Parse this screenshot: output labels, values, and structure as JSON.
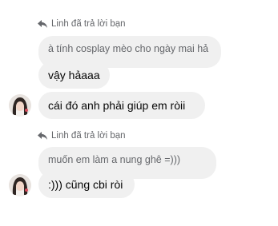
{
  "thread": {
    "blocks": [
      {
        "reply_label": "Linh đã trả lời bạn",
        "quoted_text": "à tính cosplay mèo cho ngày mai hả",
        "reply_text": "vậy hảaaa"
      },
      {
        "message_text": "cái đó anh phải giúp em ròii"
      },
      {
        "reply_label": "Linh đã trả lời bạn",
        "quoted_text": "muốn em làm a nung ghê =)))",
        "reply_text": ":))) cũng cbi ròi"
      }
    ]
  },
  "icons": {
    "reply": "reply-arrow-icon",
    "avatar": "profile-avatar"
  },
  "colors": {
    "bubble_bg": "#f0f0f0",
    "meta_text": "#65676b",
    "text": "#050505"
  }
}
